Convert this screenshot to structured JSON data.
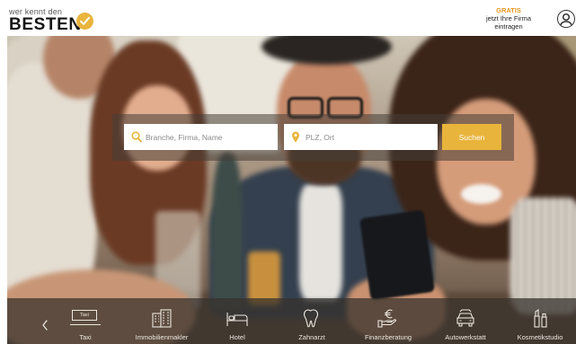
{
  "header": {
    "logo_top": "wer kennt den",
    "logo_main": "BESTEN",
    "cta_highlight": "GRATIS",
    "cta_line1": "jetzt Ihre Firma",
    "cta_line2": "eintragen"
  },
  "search": {
    "what_placeholder": "Branche, Firma, Name",
    "where_placeholder": "PLZ, Ort",
    "button_label": "Suchen"
  },
  "categories": {
    "items": [
      {
        "label": "Taxi",
        "icon": "taxi-sign-icon",
        "sign_text": "Taxi"
      },
      {
        "label": "Immobilienmakler",
        "icon": "buildings-icon"
      },
      {
        "label": "Hotel",
        "icon": "bed-icon"
      },
      {
        "label": "Zahnarzt",
        "icon": "tooth-icon"
      },
      {
        "label": "Finanzberatung",
        "icon": "euro-hand-icon"
      },
      {
        "label": "Autowerkstatt",
        "icon": "car-icon"
      },
      {
        "label": "Kosmetikstudio",
        "icon": "cosmetics-icon"
      }
    ]
  },
  "icons": {
    "logo_badge": "check-badge-icon",
    "user": "user-account-icon",
    "search": "search-icon",
    "location": "location-pin-icon",
    "prev": "chevron-left-icon"
  },
  "colors": {
    "accent": "#e9b43c",
    "highlight": "#e8961e",
    "header_bg": "#ffffff",
    "overlay": "#463e37"
  }
}
